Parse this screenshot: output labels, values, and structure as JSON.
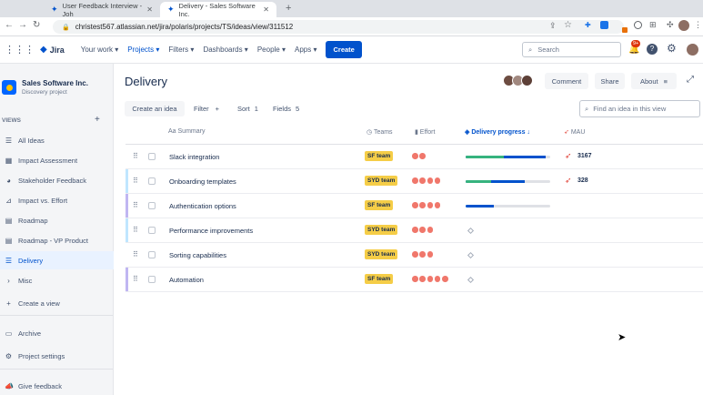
{
  "browser": {
    "tabs": [
      {
        "title": "User Feedback Interview - Joh"
      },
      {
        "title": "Delivery - Sales Software Inc."
      }
    ],
    "url": "christest567.atlassian.net/jira/polaris/projects/TS/ideas/view/311512"
  },
  "nav": {
    "logo": "Jira",
    "items": [
      "Your work",
      "Projects",
      "Filters",
      "Dashboards",
      "People",
      "Apps"
    ],
    "create_label": "Create",
    "search_placeholder": "Search",
    "notifications_badge": "9+"
  },
  "project": {
    "name": "Sales Software Inc.",
    "type": "Discovery project"
  },
  "sidebar": {
    "views_label": "VIEWS",
    "items": [
      {
        "label": "All Ideas"
      },
      {
        "label": "Impact Assessment"
      },
      {
        "label": "Stakeholder Feedback"
      },
      {
        "label": "Impact vs. Effort"
      },
      {
        "label": "Roadmap"
      },
      {
        "label": "Roadmap - VP Product"
      },
      {
        "label": "Delivery"
      },
      {
        "label": "Misc"
      }
    ],
    "create_view": "Create a view",
    "archive": "Archive",
    "project_settings": "Project settings",
    "give_feedback": "Give feedback"
  },
  "page": {
    "title": "Delivery",
    "comment_label": "Comment",
    "share_label": "Share",
    "about_label": "About",
    "create_idea_label": "Create an idea",
    "filter_label": "Filter",
    "sort_label": "Sort",
    "sort_count": "1",
    "fields_label": "Fields",
    "fields_count": "5",
    "find_placeholder": "Find an idea in this view"
  },
  "table": {
    "columns": {
      "summary": "Summary",
      "teams": "Teams",
      "effort": "Effort",
      "delivery": "Delivery progress",
      "mau": "MAU"
    },
    "rows": [
      {
        "summary": "Slack integration",
        "team": "SF team",
        "effort": 2,
        "progress": [
          0.45,
          0.5
        ],
        "mau": "3167"
      },
      {
        "summary": "Onboarding templates",
        "team": "SYD team",
        "effort": 4,
        "progress": [
          0.3,
          0.4
        ],
        "mau": "328"
      },
      {
        "summary": "Authentication options",
        "team": "SF team",
        "effort": 4,
        "progress": [
          0,
          0.33
        ],
        "mau": ""
      },
      {
        "summary": "Performance improvements",
        "team": "SYD team",
        "effort": 3,
        "progress": null,
        "mau": ""
      },
      {
        "summary": "Sorting capabilities",
        "team": "SYD team",
        "effort": 3,
        "progress": null,
        "mau": ""
      },
      {
        "summary": "Automation",
        "team": "SF team",
        "effort": 5,
        "progress": null,
        "mau": ""
      }
    ]
  },
  "colors": {
    "accent": "#0052cc",
    "team_badge": "#f5cd47",
    "effort_dot": "#f0776b",
    "progress_done": "#36b37e",
    "progress_in_progress": "#0052cc",
    "progress_todo": "#dfe1e6"
  }
}
